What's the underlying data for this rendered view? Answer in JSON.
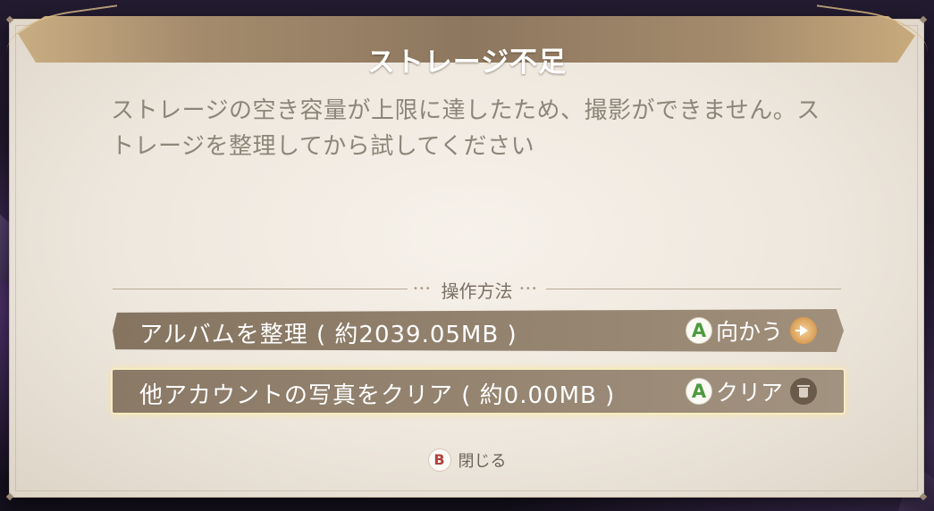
{
  "dialog": {
    "title": "ストレージ不足",
    "message": "ストレージの空き容量が上限に達したため、撮影ができません。ストレージを整理してから試してください",
    "section_label": "操作方法",
    "options": [
      {
        "label": "アルバムを整理 ( 約2039.05MB )",
        "button_glyph": "A",
        "action": "向かう",
        "icon": "arrow-right-icon",
        "selected": false
      },
      {
        "label": "他アカウントの写真をクリア ( 約0.00MB )",
        "button_glyph": "A",
        "action": "クリア",
        "icon": "trash-icon",
        "selected": true
      }
    ],
    "close": {
      "button_glyph": "B",
      "label": "閉じる"
    }
  },
  "colors": {
    "accent_gold": "#d89c55",
    "a_button": "#4c9a3e",
    "b_button": "#b2413a",
    "selection_glow": "#f6ecc2"
  }
}
